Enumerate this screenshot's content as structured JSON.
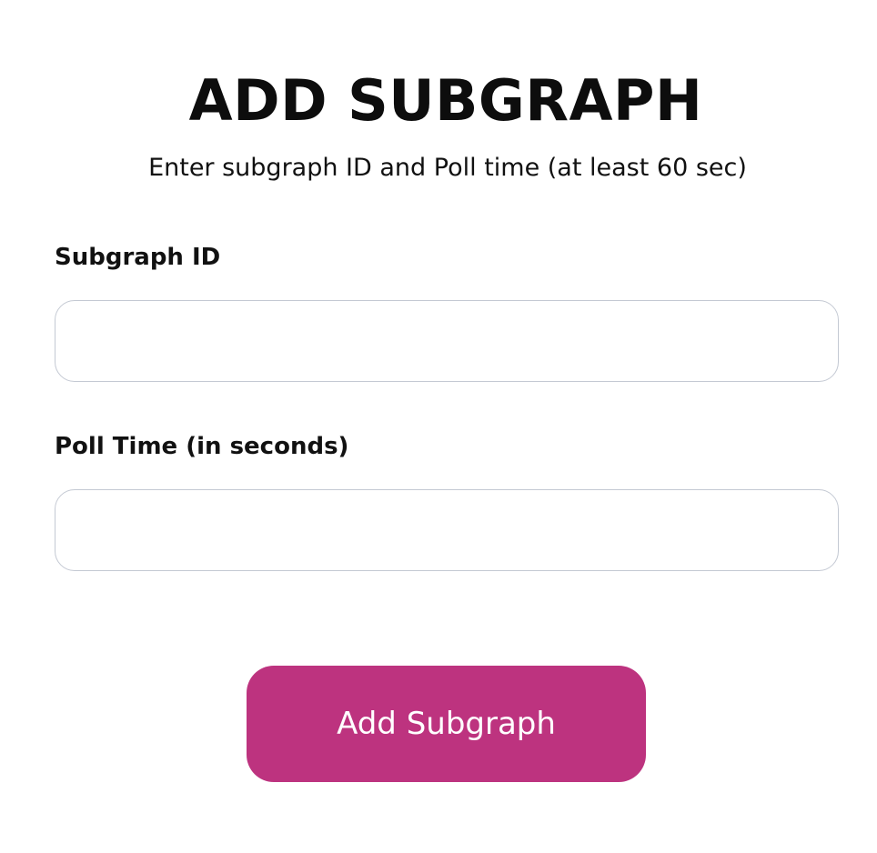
{
  "form": {
    "title": "ADD SUBGRAPH",
    "subtitle": "Enter subgraph ID and Poll time (at least 60 sec)",
    "subgraph_id": {
      "label": "Subgraph ID",
      "value": "",
      "placeholder": ""
    },
    "poll_time": {
      "label": "Poll Time (in seconds)",
      "value": "",
      "placeholder": ""
    },
    "submit_label": "Add Subgraph"
  },
  "colors": {
    "accent": "#bd337f",
    "input_border": "#c4c9d3",
    "text": "#111111",
    "background": "#ffffff"
  }
}
